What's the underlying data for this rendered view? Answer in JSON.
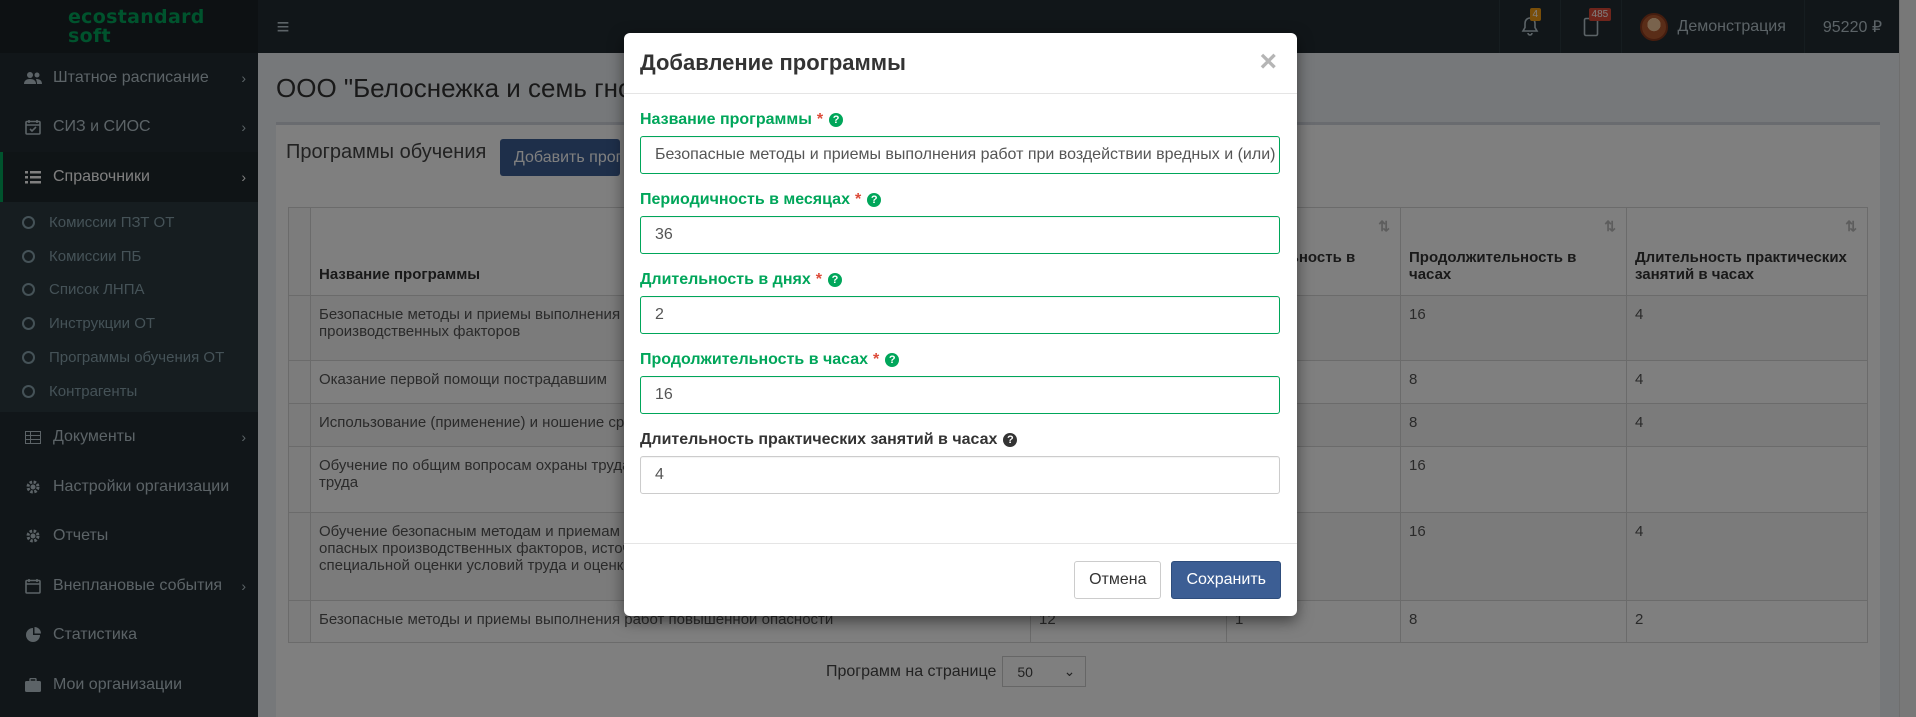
{
  "header": {
    "logo_line1": "ecostandard",
    "logo_line2": "soft",
    "notifications_count": "4",
    "tasks_count": "485",
    "user_name": "Демонстрация",
    "balance": "95220 ₽"
  },
  "sidebar": {
    "items": [
      {
        "label": "Штатное расписание"
      },
      {
        "label": "СИЗ и СИОС"
      },
      {
        "label": "Справочники"
      },
      {
        "label": "Документы"
      },
      {
        "label": "Настройки организации"
      },
      {
        "label": "Отчеты"
      },
      {
        "label": "Внеплановые события"
      },
      {
        "label": "Статистика"
      },
      {
        "label": "Мои организации"
      }
    ],
    "submenu": [
      {
        "label": "Комиссии ПЗТ ОТ"
      },
      {
        "label": "Комиссии ПБ"
      },
      {
        "label": "Список ЛНПА"
      },
      {
        "label": "Инструкции ОТ"
      },
      {
        "label": "Программы обучения ОТ"
      },
      {
        "label": "Контрагенты"
      }
    ]
  },
  "main": {
    "org_title": "ООО \"Белоснежка и семь гномов\"",
    "section_title": "Программы обучения",
    "add_button": "Добавить программу",
    "columns": {
      "name": "Название программы",
      "c2": "",
      "c3": "Длительность в днях",
      "c4": "Продолжительность в часах",
      "c5": "Длительность практических занятий в часах"
    },
    "rows": [
      {
        "name": "Безопасные методы и приемы выполнения работ при воздействии вредных и (или) опасных производственных факторов",
        "c4": "16",
        "c5": "4"
      },
      {
        "name": "Оказание первой помощи пострадавшим",
        "c4": "8",
        "c5": "4"
      },
      {
        "name": "Использование (применение) и ношение средств индивидуальной защиты",
        "c4": "8",
        "c5": "4"
      },
      {
        "name": "Обучение по общим вопросам охраны труда и функционирования системы управления охраной труда",
        "c4": "16",
        "c5": ""
      },
      {
        "name": "Обучение безопасным методам и приемам выполнения работ при воздействии вредных и (или) опасных производственных факторов, источников опасности, идентифицированных в рамках специальной оценки условий труда и оценки профессиональных рисков",
        "c4": "16",
        "c5": "4"
      },
      {
        "name": "Безопасные методы и приемы выполнения работ повышенной опасности",
        "c2": "12",
        "c3": "1",
        "c4": "8",
        "c5": "2"
      }
    ],
    "pager_label": "Программ на странице",
    "pager_value": "50"
  },
  "modal": {
    "title": "Добавление программы",
    "close": "×",
    "fields": {
      "name": {
        "label": "Название программы",
        "required": "*",
        "value": "Безопасные методы и приемы выполнения работ при воздействии вредных и (или) опасных производственных факторов"
      },
      "period": {
        "label": "Периодичность в месяцах",
        "required": "*",
        "value": "36"
      },
      "days": {
        "label": "Длительность в днях",
        "required": "*",
        "value": "2"
      },
      "hours": {
        "label": "Продолжительность в часах",
        "required": "*",
        "value": "16"
      },
      "practice": {
        "label": "Длительность практических занятий в часах",
        "value": "4"
      }
    },
    "cancel": "Отмена",
    "save": "Сохранить"
  },
  "colors": {
    "accent": "#00a65a",
    "primary": "#3c5e94",
    "sidebar": "#222d32"
  }
}
